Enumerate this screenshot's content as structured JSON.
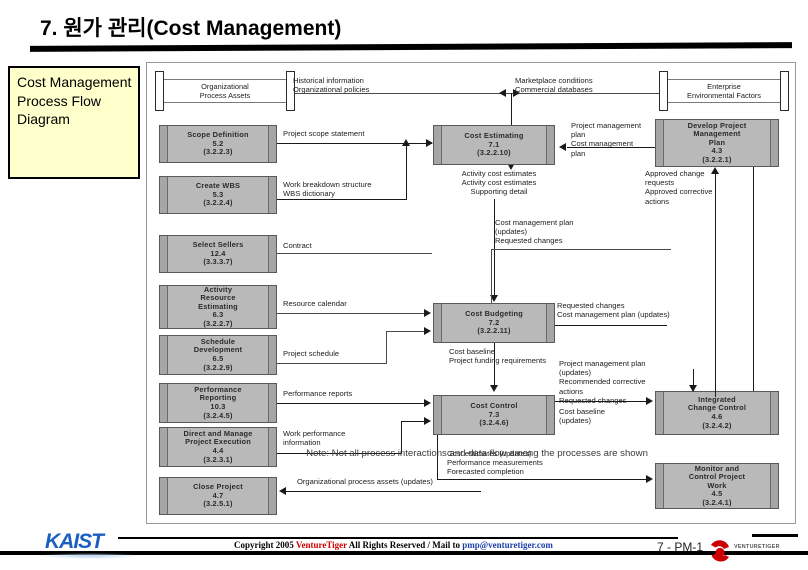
{
  "slide": {
    "title": "7. 원가 관리(Cost Management)",
    "note_box": "Cost\nManagement\nProcess\nFlow\nDiagram",
    "diagram_note": "Note:  Not all process interactions and data flow among the processes are shown",
    "page_number": "7 - PM-1"
  },
  "stores": [
    {
      "name": "organizational-process-assets",
      "label": "Organizational\nProcess Assets"
    },
    {
      "name": "enterprise-environmental-factors",
      "label": "Enterprise\nEnvironmental Factors"
    }
  ],
  "processes": [
    {
      "name": "scope-definition",
      "label": "Scope Definition\n5.2\n(3.2.2.3)"
    },
    {
      "name": "create-wbs",
      "label": "Create WBS\n5.3\n(3.2.2.4)"
    },
    {
      "name": "select-sellers",
      "label": "Select Sellers\n12.4\n(3.3.3.7)"
    },
    {
      "name": "activity-resource-estimating",
      "label": "Activity\nResource\nEstimating\n6.3\n(3.2.2.7)"
    },
    {
      "name": "schedule-development",
      "label": "Schedule\nDevelopment\n6.5\n(3.2.2.9)"
    },
    {
      "name": "performance-reporting",
      "label": "Performance\nReporting\n10.3\n(3.2.4.5)"
    },
    {
      "name": "direct-and-manage-project-execution",
      "label": "Direct and Manage\nProject Execution\n4.4\n(3.2.3.1)"
    },
    {
      "name": "close-project",
      "label": "Close Project\n4.7\n(3.2.5.1)"
    },
    {
      "name": "cost-estimating",
      "label": "Cost Estimating\n7.1\n(3.2.2.10)"
    },
    {
      "name": "cost-budgeting",
      "label": "Cost Budgeting\n7.2\n(3.2.2.11)"
    },
    {
      "name": "cost-control",
      "label": "Cost Control\n7.3\n(3.2.4.6)"
    },
    {
      "name": "develop-project-management-plan",
      "label": "Develop Project\nManagement\nPlan\n4.3\n(3.2.2.1)"
    },
    {
      "name": "integrated-change-control",
      "label": "Integrated\nChange Control\n4.6\n(3.2.4.2)"
    },
    {
      "name": "monitor-and-control-project-work",
      "label": "Monitor and\nControl Project\nWork\n4.5\n(3.2.4.1)"
    }
  ],
  "flows": [
    {
      "name": "flow-historical-information",
      "label": "Historical information\nOrganizational policies"
    },
    {
      "name": "flow-marketplace-conditions",
      "label": "Marketplace conditions\nCommercial databases"
    },
    {
      "name": "flow-project-scope-statement",
      "label": "Project scope statement"
    },
    {
      "name": "flow-work-breakdown-structure",
      "label": "Work breakdown structure\nWBS dictionary"
    },
    {
      "name": "flow-project-management-plan",
      "label": "Project management\nplan\nCost management\nplan"
    },
    {
      "name": "flow-activity-cost-estimates",
      "label": "Activity cost estimates\nActivity cost estimates\nSupporting detail"
    },
    {
      "name": "flow-approved-change-requests",
      "label": "Approved change\nrequests\nApproved corrective\nactions"
    },
    {
      "name": "flow-cost-management-plan-updates",
      "label": "Cost management plan\n   (updates)\nRequested changes"
    },
    {
      "name": "flow-contract",
      "label": "Contract"
    },
    {
      "name": "flow-resource-calendar",
      "label": "Resource calendar"
    },
    {
      "name": "flow-project-schedule",
      "label": "Project schedule"
    },
    {
      "name": "flow-requested-changes-budget",
      "label": "Requested changes\nCost management plan (updates)"
    },
    {
      "name": "flow-cost-baseline",
      "label": "Cost baseline\nProject funding requirements"
    },
    {
      "name": "flow-performance-reports",
      "label": "Performance reports"
    },
    {
      "name": "flow-work-performance-information",
      "label": "Work performance\ninformation"
    },
    {
      "name": "flow-project-management-plan-updates",
      "label": "Project management plan\n   (updates)\nRecommended corrective\n   actions\nRequested changes"
    },
    {
      "name": "flow-cost-baseline-updates",
      "label": "Cost baseline\n(updates)"
    },
    {
      "name": "flow-organizational-process-assets-updates",
      "label": "Organizational process assets (updates)"
    },
    {
      "name": "flow-cost-estimates-updates",
      "label": "Cost estimates (updates)\nPerformance measurements\nForecasted completion"
    }
  ],
  "footer": {
    "copyright_prefix": "Copyright 2005 ",
    "brand": "VentureTiger",
    "copyright_mid": " All Rights Reserved / Mail to ",
    "mail": "pmp@venturetiger.com",
    "kaist": "KAIST",
    "brand_mark": "VENTURETIGER"
  },
  "colors": {
    "note_fill": "#ffffcc",
    "process_fill": "#a6a6a6",
    "brand_red": "#cc0000",
    "kaist_blue": "#1b5fc1"
  }
}
